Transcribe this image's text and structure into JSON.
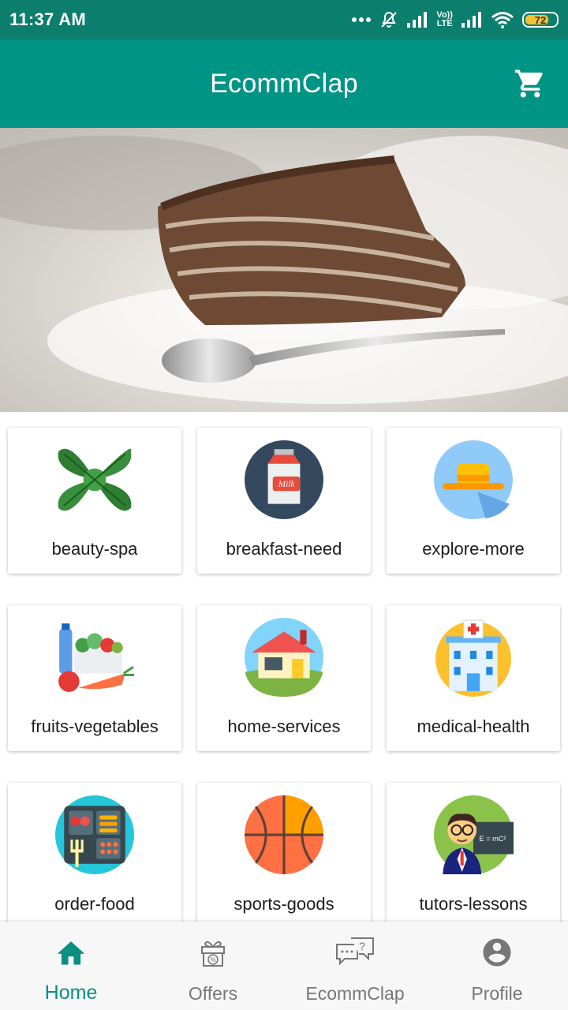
{
  "status_bar": {
    "time": "11:37 AM",
    "battery": "72",
    "network": "LTE",
    "carrier": "Vo))"
  },
  "app_bar": {
    "title": "EcommClap",
    "cart_icon": "shopping-cart-icon"
  },
  "hero": {
    "image": "chocolate-cake-slice-with-spoon"
  },
  "categories": [
    {
      "label": "beauty-spa",
      "icon": "basil-leaf-icon"
    },
    {
      "label": "breakfast-need",
      "icon": "milk-carton-icon"
    },
    {
      "label": "explore-more",
      "icon": "hat-icon"
    },
    {
      "label": "fruits-vegetables",
      "icon": "groceries-icon"
    },
    {
      "label": "home-services",
      "icon": "house-icon"
    },
    {
      "label": "medical-health",
      "icon": "hospital-icon"
    },
    {
      "label": "order-food",
      "icon": "lunch-tray-icon"
    },
    {
      "label": "sports-goods",
      "icon": "basketball-icon"
    },
    {
      "label": "tutors-lessons",
      "icon": "teacher-icon"
    }
  ],
  "bottom_nav": [
    {
      "label": "Home",
      "icon": "home-icon",
      "active": true
    },
    {
      "label": "Offers",
      "icon": "gift-icon",
      "active": false
    },
    {
      "label": "EcommClap",
      "icon": "chat-question-icon",
      "active": false
    },
    {
      "label": "Profile",
      "icon": "account-circle-icon",
      "active": false
    }
  ],
  "colors": {
    "status_bar": "#0b7e6d",
    "app_bar": "#009485",
    "active_nav": "#0a8f80",
    "inactive_nav": "#777777"
  }
}
